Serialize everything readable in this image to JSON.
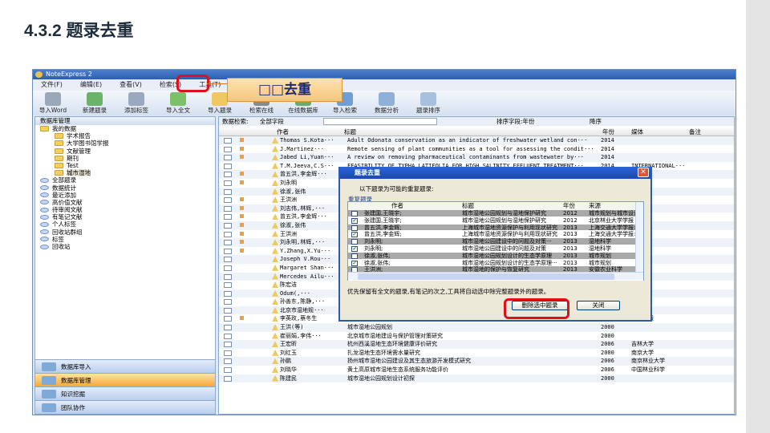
{
  "slide": {
    "title": "4.3.2 题录去重"
  },
  "callout": {
    "text": "□□去重"
  },
  "window": {
    "title": "NoteExpress 2",
    "menu": [
      "文件(F)",
      "编辑(E)",
      "查看(V)",
      "检索(S)",
      "工具(T)"
    ],
    "toolbar": [
      "导入Word",
      "新建题录",
      "添加标签",
      "导入全文",
      "导入题录",
      "检索在线",
      "在线数据库",
      "导入检索",
      "数据分析",
      "题录排序"
    ],
    "left": {
      "header": "数据库管理",
      "tree": [
        {
          "label": "我的数据",
          "type": "folder",
          "indent": 0
        },
        {
          "label": "学术报告",
          "type": "folder",
          "indent": 1
        },
        {
          "label": "大学图书馆学报",
          "type": "folder",
          "indent": 1
        },
        {
          "label": "文献管理",
          "type": "folder",
          "indent": 1
        },
        {
          "label": "期刊",
          "type": "folder",
          "indent": 1
        },
        {
          "label": "Test",
          "type": "folder",
          "indent": 1
        },
        {
          "label": "城市湿地",
          "type": "folder",
          "indent": 1,
          "selected": true
        },
        {
          "label": "全部题录",
          "type": "disk",
          "indent": 0
        },
        {
          "label": "数据统计",
          "type": "disk",
          "indent": 0
        },
        {
          "label": "最近添加",
          "type": "disk",
          "indent": 0
        },
        {
          "label": "高价值文献",
          "type": "disk",
          "indent": 0
        },
        {
          "label": "待审阅文献",
          "type": "disk",
          "indent": 0
        },
        {
          "label": "有笔记文献",
          "type": "disk",
          "indent": 0
        },
        {
          "label": "个人标签",
          "type": "disk",
          "indent": 0
        },
        {
          "label": "回收站群组",
          "type": "disk",
          "indent": 0
        },
        {
          "label": "标签",
          "type": "disk",
          "indent": 0
        },
        {
          "label": "回收站",
          "type": "disk",
          "indent": 0
        }
      ],
      "nav": [
        {
          "label": "数据库导入",
          "active": false
        },
        {
          "label": "数据库管理",
          "active": true
        },
        {
          "label": "知识挖掘",
          "active": false
        },
        {
          "label": "团队协作",
          "active": false
        }
      ]
    },
    "right": {
      "search_label": "数据检索:",
      "search_scope": "全部字段",
      "search_value": "",
      "sort_label": "排序字段:年份",
      "order": "降序",
      "columns": [
        "作者",
        "标题",
        "年份",
        "媒体",
        "备注"
      ],
      "rows": [
        {
          "author": "Thomas S.Kota···",
          "title": "Adult Odonata conservation as an indicator of freshwater wetland con···",
          "year": "2014",
          "source": "",
          "flag": true
        },
        {
          "author": "J.Martinez···",
          "title": "Remote sensing of plant communities as a tool for assessing the condit···",
          "year": "2014",
          "source": "",
          "flag": true
        },
        {
          "author": "Jabed Li,Yuan···",
          "title": "A review on removing pharmaceutical contaminants from wastewater by···",
          "year": "2014",
          "source": "",
          "flag": true
        },
        {
          "author": "T.M.Jeeva,C.S···",
          "title": "FEASIBILITY OF TYPHA LATIFOLIA FOR HIGH SALINITY EFFLUENT TREATMENT···",
          "year": "2014",
          "source": "INTERNATIONAL···",
          "flag": false
        },
        {
          "author": "曾五洪,李金辉···",
          "title": "",
          "year": "",
          "source": "报···",
          "flag": true
        },
        {
          "author": "刘永明",
          "title": "",
          "year": "",
          "source": "",
          "flag": true
        },
        {
          "author": "徐淑,张伟",
          "title": "",
          "year": "",
          "source": "",
          "flag": false
        },
        {
          "author": "王洪洲",
          "title": "",
          "year": "",
          "source": "报",
          "flag": true
        },
        {
          "author": "刘志伟,林辉,···",
          "title": "",
          "year": "",
          "source": "研究",
          "flag": true
        },
        {
          "author": "曾五洪,李金辉···",
          "title": "",
          "year": "",
          "source": "报···",
          "flag": true
        },
        {
          "author": "徐淑,张伟",
          "title": "",
          "year": "",
          "source": "",
          "flag": true
        },
        {
          "author": "王洪洲",
          "title": "",
          "year": "",
          "source": "报",
          "flag": true
        },
        {
          "author": "刘永明,林辉,···",
          "title": "",
          "year": "",
          "source": "管理",
          "flag": true
        },
        {
          "author": "Y.Zhang,X.Yu···",
          "title": "",
          "year": "",
          "source": "",
          "flag": true
        },
        {
          "author": "Joseph V.Rou···",
          "title": "",
          "year": "",
          "source": "TAL···",
          "flag": false
        },
        {
          "author": "Margaret Shan···",
          "title": "",
          "year": "",
          "source": "TAL···",
          "flag": false
        },
        {
          "author": "Mercedes Ailu···",
          "title": "",
          "year": "",
          "source": "AL···",
          "flag": false
        },
        {
          "author": "陈宏洁",
          "title": "",
          "year": "",
          "source": "",
          "flag": false
        },
        {
          "author": "Odum(,···",
          "title": "",
          "year": "",
          "source": "",
          "flag": false
        },
        {
          "author": "孙善东,陈静,···",
          "title": "",
          "year": "",
          "source": "学报",
          "flag": false
        },
        {
          "author": "北京市湿地规···",
          "title": "",
          "year": "",
          "source": "",
          "flag": false
        },
        {
          "author": "李英玫,蔡冬生",
          "title": "Ontology在城市湿地信息分类与集成中的应用研究",
          "year": "2010",
          "source": "测绘通报",
          "flag": true
        },
        {
          "author": "王洪(等)",
          "title": "城市湿地公园规划",
          "year": "2000",
          "source": "",
          "flag": false
        },
        {
          "author": "崔丽娟,李伟···",
          "title": "北京城市湿地建设与保护管理对策研究",
          "year": "2000",
          "source": "",
          "flag": false
        },
        {
          "author": "王宏昕",
          "title": "杭州西溪湿地生态环境健康评价研究",
          "year": "2006",
          "source": "吉林大学",
          "flag": false
        },
        {
          "author": "刘红玉",
          "title": "扎龙湿地生态环境需水量研究",
          "year": "2000",
          "source": "南京大学",
          "flag": false
        },
        {
          "author": "孙鹏",
          "title": "扬州城市湿地公园建设及其生态旅游开发模式研究",
          "year": "2006",
          "source": "南京林业大学",
          "flag": false
        },
        {
          "author": "刘晓华",
          "title": "黄土高原城市湿地生态系统服务功能评价",
          "year": "2006",
          "source": "中国林业科学",
          "flag": false
        },
        {
          "author": "陈建民",
          "title": "城市湿地公园规划设计初探",
          "year": "2000",
          "source": "",
          "flag": false
        }
      ]
    },
    "dialog": {
      "title": "题录去重",
      "prompt": "以下题录为可能的重复题录:",
      "group": "重复题录",
      "columns": [
        "作者",
        "标题",
        "年份",
        "来源"
      ],
      "rows": [
        {
          "checked": false,
          "gray": true,
          "author": "张建国,王晓宇;",
          "title": "城市湿地公园规划与湿地保护研究",
          "year": "2012",
          "source": "城市规划与城市设计"
        },
        {
          "checked": true,
          "gray": false,
          "author": "张建国,王晓宇;",
          "title": "城市湿地公园规划与湿地保护研究",
          "year": "2012",
          "source": "北京林业大学学报"
        },
        {
          "checked": false,
          "gray": true,
          "author": "曾五洪,李金辉;",
          "title": "上海城市湿地资源保护与利用现状研究···",
          "year": "2013",
          "source": "上海交通大学学报:自然"
        },
        {
          "checked": true,
          "gray": false,
          "author": "曾五洪,李金辉;",
          "title": "上海城市湿地资源保护与利用现状研究",
          "year": "2013",
          "source": "上海交通大学学报:自然"
        },
        {
          "checked": false,
          "gray": true,
          "author": "刘永明;",
          "title": "城市湿地公园建设中的问题及对策···",
          "year": "2013",
          "source": "湿地科学"
        },
        {
          "checked": true,
          "gray": false,
          "author": "刘永明;",
          "title": "城市湿地公园建设中的问题及对策",
          "year": "2013",
          "source": "湿地科学"
        },
        {
          "checked": false,
          "gray": true,
          "author": "徐淑,张伟;",
          "title": "城市湿地公园规划设计的生态学原理",
          "year": "2013",
          "source": "城市规划"
        },
        {
          "checked": true,
          "gray": false,
          "author": "徐淑,张伟;",
          "title": "城市湿地公园规划设计的生态学原理···",
          "year": "2013",
          "source": "城市规划"
        },
        {
          "checked": false,
          "gray": true,
          "author": "王洪洲;",
          "title": "城市湿地的保护与恢复研究",
          "year": "2013",
          "source": "安徽农业科学"
        },
        {
          "checked": true,
          "gray": false,
          "author": "王洪洲;",
          "title": "城市湿地的保护与恢复研究进展···",
          "year": "2013",
          "source": "安徽农业科学"
        }
      ],
      "note": "优先保留有全文的题录,有笔记的次之,工具将自动选中除完整题录外的题录。",
      "delete_button": "删除选中题录",
      "close_button": "关闭"
    }
  }
}
